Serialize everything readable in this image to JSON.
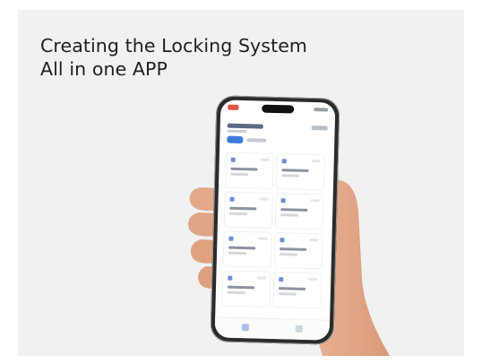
{
  "headline": {
    "line1": "Creating the Locking System",
    "line2": "All in one APP"
  },
  "colors": {
    "card_background": "#f1f1f1",
    "headline_text": "#1f1f1f",
    "phone_frame": "#2b2b2b",
    "accent": "#3b7bdc"
  },
  "phone_screen": {
    "icon": "smart-lock-app-screen",
    "tiles_count_visible": 8
  }
}
